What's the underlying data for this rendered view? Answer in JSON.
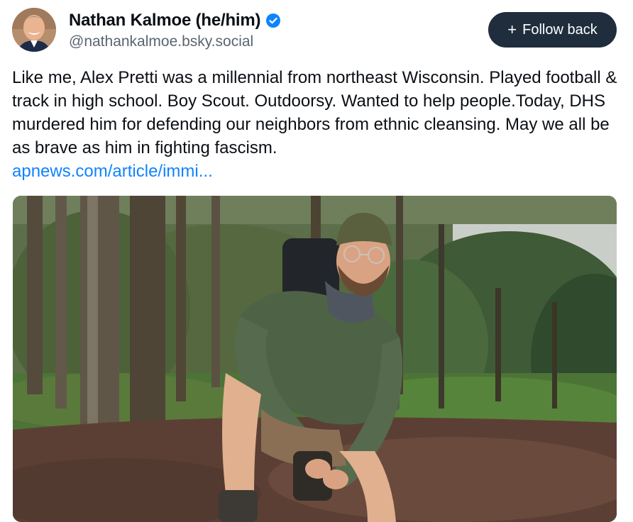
{
  "author": {
    "display_name": "Nathan Kalmoe (he/him)",
    "handle": "@nathankalmoe.bsky.social",
    "verified": true,
    "avatar_icon": "avatar-photo"
  },
  "follow_button": {
    "label": "Follow back",
    "icon": "plus-icon",
    "background": "#1f2d3d"
  },
  "post": {
    "text": "Like me, Alex Pretti was a millennial from northeast Wisconsin. Played football & track in high school. Boy Scout. Outdoorsy. Wanted to help people.Today, DHS murdered him for defending our neighbors from ethnic cleansing. May we all be as brave as him in fighting fascism.",
    "link_text": "apnews.com/article/immi...",
    "link_color": "#1083fe",
    "image_icon": "forest-hiker-photo"
  },
  "colors": {
    "verified_badge": "#1083fe",
    "handle_text": "#5a6570"
  }
}
